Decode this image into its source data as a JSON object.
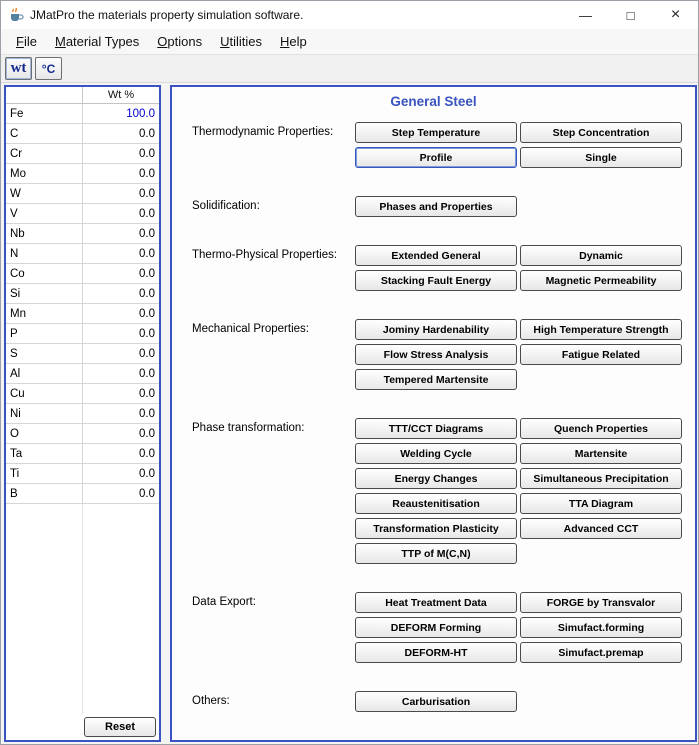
{
  "window": {
    "title": "JMatPro the materials property simulation software.",
    "controls": {
      "minimize": "—",
      "maximize": "□",
      "close": "×"
    }
  },
  "menu": {
    "items": [
      "File",
      "Material Types",
      "Options",
      "Utilities",
      "Help"
    ]
  },
  "toolbar": {
    "weight_button": "wt",
    "temperature_button": "°C"
  },
  "composition": {
    "header": "Wt %",
    "reset_label": "Reset",
    "rows": [
      {
        "element": "Fe",
        "value": "100.0",
        "highlight": true
      },
      {
        "element": "C",
        "value": "0.0",
        "highlight": false
      },
      {
        "element": "Cr",
        "value": "0.0",
        "highlight": false
      },
      {
        "element": "Mo",
        "value": "0.0",
        "highlight": false
      },
      {
        "element": "W",
        "value": "0.0",
        "highlight": false
      },
      {
        "element": "V",
        "value": "0.0",
        "highlight": false
      },
      {
        "element": "Nb",
        "value": "0.0",
        "highlight": false
      },
      {
        "element": "N",
        "value": "0.0",
        "highlight": false
      },
      {
        "element": "Co",
        "value": "0.0",
        "highlight": false
      },
      {
        "element": "Si",
        "value": "0.0",
        "highlight": false
      },
      {
        "element": "Mn",
        "value": "0.0",
        "highlight": false
      },
      {
        "element": "P",
        "value": "0.0",
        "highlight": false
      },
      {
        "element": "S",
        "value": "0.0",
        "highlight": false
      },
      {
        "element": "Al",
        "value": "0.0",
        "highlight": false
      },
      {
        "element": "Cu",
        "value": "0.0",
        "highlight": false
      },
      {
        "element": "Ni",
        "value": "0.0",
        "highlight": false
      },
      {
        "element": "O",
        "value": "0.0",
        "highlight": false
      },
      {
        "element": "Ta",
        "value": "0.0",
        "highlight": false
      },
      {
        "element": "Ti",
        "value": "0.0",
        "highlight": false
      },
      {
        "element": "B",
        "value": "0.0",
        "highlight": false
      }
    ]
  },
  "main": {
    "title": "General Steel",
    "focused_button": "Profile",
    "sections": [
      {
        "label": "Thermodynamic Properties:",
        "buttons": [
          "Step Temperature",
          "Step Concentration",
          "Profile",
          "Single"
        ]
      },
      {
        "label": "Solidification:",
        "buttons": [
          "Phases and Properties"
        ]
      },
      {
        "label": "Thermo-Physical Properties:",
        "buttons": [
          "Extended General",
          "Dynamic",
          "Stacking Fault Energy",
          "Magnetic Permeability"
        ]
      },
      {
        "label": "Mechanical Properties:",
        "buttons": [
          "Jominy Hardenability",
          "High Temperature Strength",
          "Flow Stress Analysis",
          "Fatigue Related",
          "Tempered Martensite"
        ]
      },
      {
        "label": "Phase transformation:",
        "buttons": [
          "TTT/CCT Diagrams",
          "Quench Properties",
          "Welding Cycle",
          "Martensite",
          "Energy Changes",
          "Simultaneous Precipitation",
          "Reaustenitisation",
          "TTA Diagram",
          "Transformation Plasticity",
          "Advanced CCT",
          "TTP of M(C,N)"
        ]
      },
      {
        "label": "Data Export:",
        "buttons": [
          "Heat Treatment Data",
          "FORGE by Transvalor",
          "DEFORM Forming",
          "Simufact.forming",
          "DEFORM-HT",
          "Simufact.premap"
        ]
      },
      {
        "label": "Others:",
        "buttons": [
          "Carburisation"
        ]
      }
    ]
  },
  "colors": {
    "panel_border_blue": "#3a53c0",
    "title_blue": "#3a53c0",
    "fe_value_blue": "#0000cd"
  }
}
